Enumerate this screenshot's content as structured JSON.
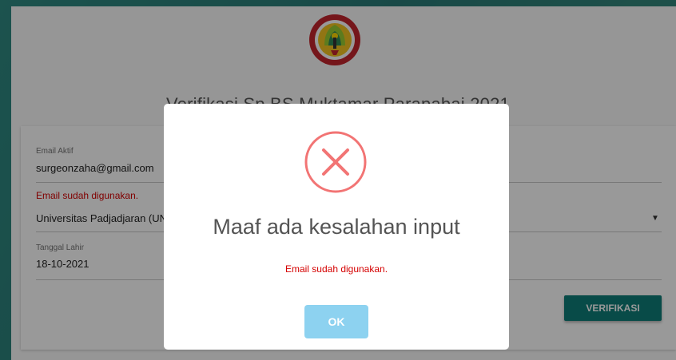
{
  "header": {
    "title": "Verifikasi Sp.BS Muktamar Parapabai 2021",
    "logo_text": "PERHIMPUNAN SPESIALIS BEDAH SARAF INDONESIA"
  },
  "form": {
    "email": {
      "label": "Email Aktif",
      "value": "surgeonzaha@gmail.com",
      "error": "Email sudah digunakan."
    },
    "university": {
      "value": "Universitas Padjadjaran (UN"
    },
    "birth_date": {
      "label": "Tanggal Lahir",
      "value": "18-10-2021"
    },
    "submit_label": "VERIFIKASI"
  },
  "dialog": {
    "icon": "error-x-icon",
    "title": "Maaf ada kesalahan input",
    "message": "Email sudah digunakan.",
    "ok_label": "OK"
  },
  "colors": {
    "accent": "#0e7e78",
    "error": "#d50000",
    "error_icon": "#f27474",
    "ok_button": "#8dd2f0"
  }
}
